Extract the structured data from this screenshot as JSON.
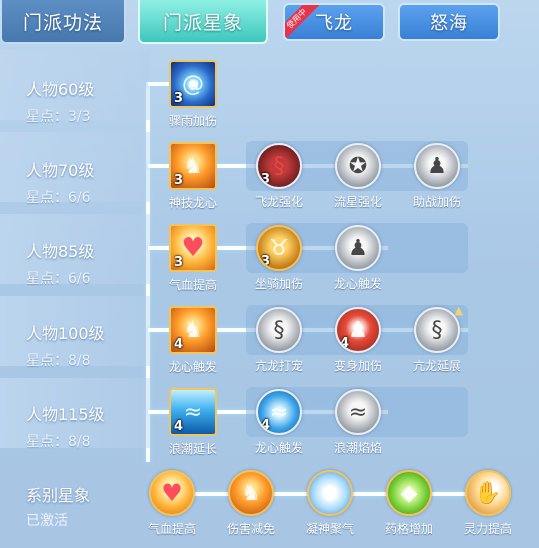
{
  "tabs": {
    "main": "门派功法",
    "star": "门派星象",
    "feilong": "飞龙",
    "feilong_badge": "使用中",
    "nuhai": "怒海"
  },
  "rows": [
    {
      "title": "人物60级",
      "points": "星点：3/3",
      "skills": [
        {
          "name": "骤雨加伤",
          "level": "3",
          "icon": "vortex-icon"
        }
      ]
    },
    {
      "title": "人物70级",
      "points": "星点：6/6",
      "skills": [
        {
          "name": "神技龙心",
          "level": "3",
          "icon": "fire-figure-icon"
        },
        {
          "name": "飞龙强化",
          "level": "3",
          "icon": "red-dragon-icon"
        },
        {
          "name": "流星强化",
          "level": "",
          "icon": "meteor-icon"
        },
        {
          "name": "助战加伤",
          "level": "",
          "icon": "meditation-figure-icon"
        }
      ]
    },
    {
      "title": "人物85级",
      "points": "星点：6/6",
      "skills": [
        {
          "name": "气血提高",
          "level": "3",
          "icon": "heart-icon"
        },
        {
          "name": "坐骑加伤",
          "level": "3",
          "icon": "beast-head-icon"
        },
        {
          "name": "龙心触发",
          "level": "",
          "icon": "figure-icon"
        }
      ]
    },
    {
      "title": "人物100级",
      "points": "星点：8/8",
      "skills": [
        {
          "name": "龙心触发",
          "level": "4",
          "icon": "fire-figure-icon"
        },
        {
          "name": "亢龙打宠",
          "level": "",
          "icon": "dragon-icon"
        },
        {
          "name": "变身加伤",
          "level": "4",
          "icon": "red-figure-icon"
        },
        {
          "name": "亢龙延展",
          "level": "",
          "icon": "dragon-icon",
          "locked": true
        }
      ]
    },
    {
      "title": "人物115级",
      "points": "星点：8/8",
      "skills": [
        {
          "name": "浪潮延长",
          "level": "4",
          "icon": "wave-icon"
        },
        {
          "name": "龙心触发",
          "level": "4",
          "icon": "wave-round-icon"
        },
        {
          "name": "浪潮焰焰",
          "level": "",
          "icon": "wave-grey-icon"
        }
      ]
    }
  ],
  "system": {
    "title": "系别星象",
    "status": "已激活",
    "skills": [
      {
        "name": "气血提高",
        "icon": "heart-icon"
      },
      {
        "name": "伤害减免",
        "icon": "fire-figure-icon"
      },
      {
        "name": "凝神聚气",
        "icon": "snow-figure-icon"
      },
      {
        "name": "药格增加",
        "icon": "jade-icon"
      },
      {
        "name": "灵力提高",
        "icon": "glow-hand-icon"
      }
    ]
  }
}
